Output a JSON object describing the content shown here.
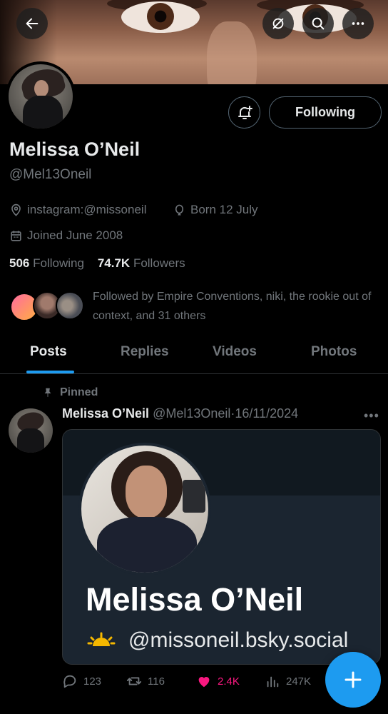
{
  "header": {
    "back_icon": "arrow-left-icon",
    "grok_icon": "grok-icon",
    "search_icon": "search-icon",
    "more_icon": "more-horizontal-icon"
  },
  "profile": {
    "notify_icon": "bell-plus-icon",
    "follow_label": "Following",
    "name": "Melissa O’Neil",
    "handle": "@Mel13Oneil",
    "website": "instagram:@missoneil",
    "birthday": "Born 12 July",
    "joined": "Joined June 2008",
    "following_count": "506",
    "following_label": "Following",
    "followers_count": "74.7K",
    "followers_label": "Followers",
    "followed_by": "Followed by Empire Conventions, niki, the rookie out of context, and 31 others"
  },
  "tabs": [
    {
      "label": "Posts",
      "active": true
    },
    {
      "label": "Replies",
      "active": false
    },
    {
      "label": "Videos",
      "active": false
    },
    {
      "label": "Photos",
      "active": false
    }
  ],
  "post": {
    "pinned_label": "Pinned",
    "author_name": "Melissa O’Neil",
    "author_handle": "@Mel13Oneil",
    "separator": "·",
    "date": "16/11/2024",
    "card_name": "Melissa O’Neil",
    "card_handle": "@missoneil.bsky.social",
    "replies": "123",
    "reposts": "116",
    "likes": "2.4K",
    "views": "247K"
  },
  "colors": {
    "accent": "#1d9bf0",
    "like": "#f91880",
    "muted": "#71767b"
  }
}
